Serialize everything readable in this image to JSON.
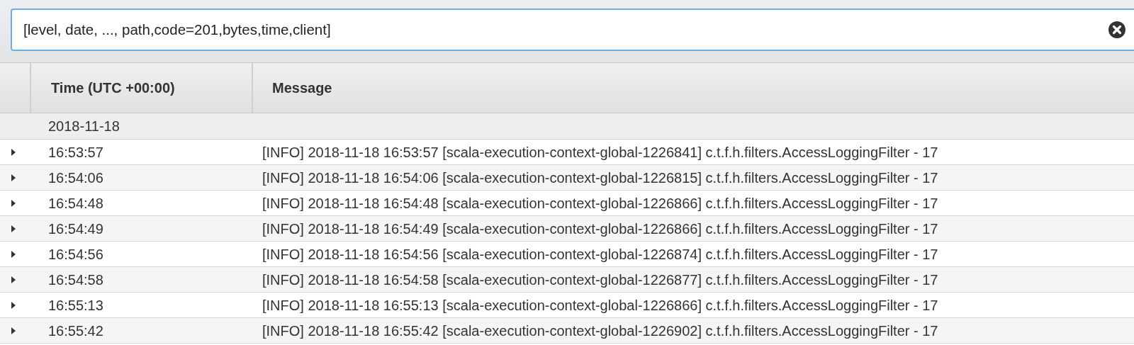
{
  "search": {
    "value": "[level, date, ..., path,code=201,bytes,time,client]"
  },
  "table": {
    "columns": [
      "Time (UTC +00:00)",
      "Message"
    ],
    "group": "2018-11-18",
    "rows": [
      {
        "time": "16:53:57",
        "message": "[INFO] 2018-11-18 16:53:57 [scala-execution-context-global-1226841] c.t.f.h.filters.AccessLoggingFilter - 17",
        "expanded": false
      },
      {
        "time": "16:54:06",
        "message": "[INFO] 2018-11-18 16:54:06 [scala-execution-context-global-1226815] c.t.f.h.filters.AccessLoggingFilter - 17",
        "expanded": false
      },
      {
        "time": "16:54:48",
        "message": "[INFO] 2018-11-18 16:54:48 [scala-execution-context-global-1226866] c.t.f.h.filters.AccessLoggingFilter - 17",
        "expanded": false
      },
      {
        "time": "16:54:49",
        "message": "[INFO] 2018-11-18 16:54:49 [scala-execution-context-global-1226866] c.t.f.h.filters.AccessLoggingFilter - 17",
        "expanded": false
      },
      {
        "time": "16:54:56",
        "message": "[INFO] 2018-11-18 16:54:56 [scala-execution-context-global-1226874] c.t.f.h.filters.AccessLoggingFilter - 17",
        "expanded": false
      },
      {
        "time": "16:54:58",
        "message": "[INFO] 2018-11-18 16:54:58 [scala-execution-context-global-1226877] c.t.f.h.filters.AccessLoggingFilter - 17",
        "expanded": false
      },
      {
        "time": "16:55:13",
        "message": "[INFO] 2018-11-18 16:55:13 [scala-execution-context-global-1226866] c.t.f.h.filters.AccessLoggingFilter - 17",
        "expanded": false
      },
      {
        "time": "16:55:42",
        "message": "[INFO] 2018-11-18 16:55:42 [scala-execution-context-global-1226902] c.t.f.h.filters.AccessLoggingFilter - 17",
        "expanded": false
      }
    ]
  }
}
